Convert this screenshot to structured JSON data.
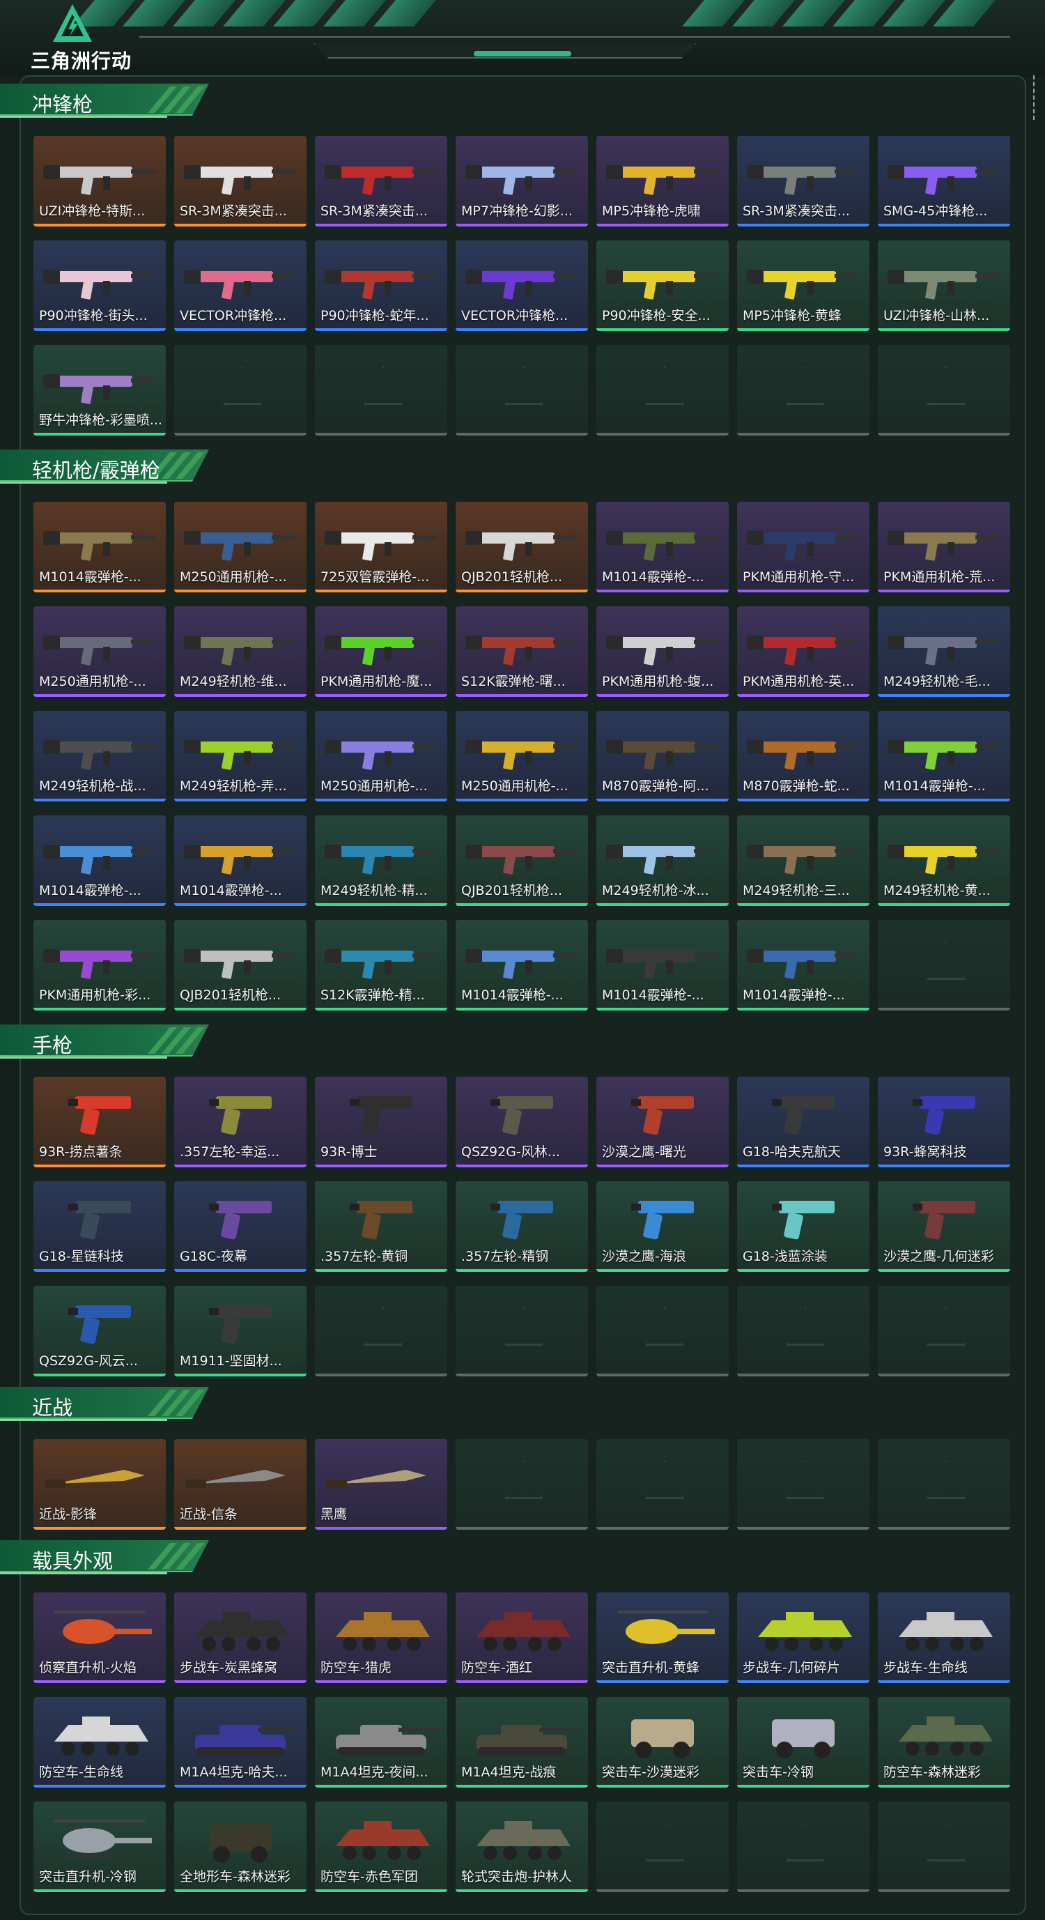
{
  "app": {
    "logo_text": "三角洲行动"
  },
  "colors": {
    "accent": "#38b586",
    "rarity_orange": "#ff8f30",
    "rarity_purple": "#9a5cff",
    "rarity_blue": "#3f82ff",
    "rarity_green": "#3bd98c"
  },
  "sections": [
    {
      "title": "冲锋枪",
      "items": [
        {
          "label": "UZI冲锋枪-特斯...",
          "rarity": "orange",
          "icon": "smg-icon",
          "tint": "#c9c9c9"
        },
        {
          "label": "SR-3M紧凑突击...",
          "rarity": "orange",
          "icon": "smg-icon",
          "tint": "#e0e0e0"
        },
        {
          "label": "SR-3M紧凑突击...",
          "rarity": "purple",
          "icon": "smg-icon",
          "tint": "#c02a2a"
        },
        {
          "label": "MP7冲锋枪-幻影...",
          "rarity": "purple",
          "icon": "smg-icon",
          "tint": "#9fb7e8"
        },
        {
          "label": "MP5冲锋枪-虎啸",
          "rarity": "purple",
          "icon": "smg-icon",
          "tint": "#e2b22a"
        },
        {
          "label": "SR-3M紧凑突击...",
          "rarity": "blue",
          "icon": "smg-icon",
          "tint": "#7a7f7c"
        },
        {
          "label": "SMG-45冲锋枪...",
          "rarity": "blue",
          "icon": "smg-icon",
          "tint": "#8a5cf0"
        },
        {
          "label": "P90冲锋枪-街头...",
          "rarity": "blue",
          "icon": "smg-icon",
          "tint": "#e9c6d6"
        },
        {
          "label": "VECTOR冲锋枪...",
          "rarity": "blue",
          "icon": "smg-icon",
          "tint": "#e36a8a"
        },
        {
          "label": "P90冲锋枪-蛇年...",
          "rarity": "blue",
          "icon": "smg-icon",
          "tint": "#b3372c"
        },
        {
          "label": "VECTOR冲锋枪...",
          "rarity": "blue",
          "icon": "smg-icon",
          "tint": "#6a3ad1"
        },
        {
          "label": "P90冲锋枪-安全...",
          "rarity": "green",
          "icon": "smg-icon",
          "tint": "#e6cf2a"
        },
        {
          "label": "MP5冲锋枪-黄蜂",
          "rarity": "green",
          "icon": "smg-icon",
          "tint": "#e8d22c"
        },
        {
          "label": "UZI冲锋枪-山林...",
          "rarity": "green",
          "icon": "smg-icon",
          "tint": "#7d8a74"
        },
        {
          "label": "野牛冲锋枪-彩墨喷...",
          "rarity": "green",
          "icon": "smg-icon",
          "tint": "#9f7fc4"
        },
        {
          "label": "",
          "rarity": "empty"
        },
        {
          "label": "",
          "rarity": "empty"
        },
        {
          "label": "",
          "rarity": "empty"
        },
        {
          "label": "",
          "rarity": "empty"
        },
        {
          "label": "",
          "rarity": "empty"
        },
        {
          "label": "",
          "rarity": "empty"
        }
      ]
    },
    {
      "title": "轻机枪/霰弹枪",
      "items": [
        {
          "label": "M1014霰弹枪-...",
          "rarity": "orange",
          "icon": "rifle-icon",
          "tint": "#8a7a4e"
        },
        {
          "label": "M250通用机枪-...",
          "rarity": "orange",
          "icon": "rifle-icon",
          "tint": "#3a5f95"
        },
        {
          "label": "725双管霰弹枪-...",
          "rarity": "orange",
          "icon": "rifle-icon",
          "tint": "#e9e9e9"
        },
        {
          "label": "QJB201轻机枪...",
          "rarity": "orange",
          "icon": "rifle-icon",
          "tint": "#d8d8d8"
        },
        {
          "label": "M1014霰弹枪-...",
          "rarity": "purple",
          "icon": "rifle-icon",
          "tint": "#5c6a3a"
        },
        {
          "label": "PKM通用机枪-守...",
          "rarity": "purple",
          "icon": "rifle-icon",
          "tint": "#2b3b6a"
        },
        {
          "label": "PKM通用机枪-荒...",
          "rarity": "purple",
          "icon": "rifle-icon",
          "tint": "#8a7a4e"
        },
        {
          "label": "M250通用机枪-...",
          "rarity": "purple",
          "icon": "rifle-icon",
          "tint": "#676a78"
        },
        {
          "label": "M249轻机枪-维...",
          "rarity": "purple",
          "icon": "rifle-icon",
          "tint": "#6e7552"
        },
        {
          "label": "PKM通用机枪-魔...",
          "rarity": "purple",
          "icon": "rifle-icon",
          "tint": "#5bd12a"
        },
        {
          "label": "S12K霰弹枪-曙...",
          "rarity": "purple",
          "icon": "rifle-icon",
          "tint": "#a33a2e"
        },
        {
          "label": "PKM通用机枪-蝮...",
          "rarity": "purple",
          "icon": "rifle-icon",
          "tint": "#cfcfcf"
        },
        {
          "label": "PKM通用机枪-英...",
          "rarity": "purple",
          "icon": "rifle-icon",
          "tint": "#b22a2a"
        },
        {
          "label": "M249轻机枪-毛...",
          "rarity": "blue",
          "icon": "rifle-icon",
          "tint": "#6a6f8a"
        },
        {
          "label": "M249轻机枪-战...",
          "rarity": "blue",
          "icon": "rifle-icon",
          "tint": "#4e4e4e"
        },
        {
          "label": "M249轻机枪-弄...",
          "rarity": "blue",
          "icon": "rifle-icon",
          "tint": "#9bd12a"
        },
        {
          "label": "M250通用机枪-...",
          "rarity": "blue",
          "icon": "rifle-icon",
          "tint": "#8a7fe0"
        },
        {
          "label": "M250通用机枪-...",
          "rarity": "blue",
          "icon": "rifle-icon",
          "tint": "#d6b02a"
        },
        {
          "label": "M870霰弹枪-阿...",
          "rarity": "blue",
          "icon": "rifle-icon",
          "tint": "#5a4a3a"
        },
        {
          "label": "M870霰弹枪-蛇...",
          "rarity": "blue",
          "icon": "rifle-icon",
          "tint": "#b06a2a"
        },
        {
          "label": "M1014霰弹枪-...",
          "rarity": "blue",
          "icon": "rifle-icon",
          "tint": "#7fd13a"
        },
        {
          "label": "M1014霰弹枪-...",
          "rarity": "blue",
          "icon": "rifle-icon",
          "tint": "#4a8fd6"
        },
        {
          "label": "M1014霰弹枪-...",
          "rarity": "blue",
          "icon": "rifle-icon",
          "tint": "#d6a02a"
        },
        {
          "label": "M249轻机枪-精...",
          "rarity": "green",
          "icon": "rifle-icon",
          "tint": "#2a86b0"
        },
        {
          "label": "QJB201轻机枪...",
          "rarity": "green",
          "icon": "rifle-icon",
          "tint": "#8a4a4a"
        },
        {
          "label": "M249轻机枪-冰...",
          "rarity": "green",
          "icon": "rifle-icon",
          "tint": "#9cc3e6"
        },
        {
          "label": "M249轻机枪-三...",
          "rarity": "green",
          "icon": "rifle-icon",
          "tint": "#8a7052"
        },
        {
          "label": "M249轻机枪-黄...",
          "rarity": "green",
          "icon": "rifle-icon",
          "tint": "#e6d02a"
        },
        {
          "label": "PKM通用机枪-彩...",
          "rarity": "green",
          "icon": "rifle-icon",
          "tint": "#9a4ad1"
        },
        {
          "label": "QJB201轻机枪...",
          "rarity": "green",
          "icon": "rifle-icon",
          "tint": "#bfbfbf"
        },
        {
          "label": "S12K霰弹枪-精...",
          "rarity": "green",
          "icon": "rifle-icon",
          "tint": "#2a8ab0"
        },
        {
          "label": "M1014霰弹枪-...",
          "rarity": "green",
          "icon": "rifle-icon",
          "tint": "#5a8ad6"
        },
        {
          "label": "M1014霰弹枪-...",
          "rarity": "green",
          "icon": "rifle-icon",
          "tint": "#3a3a3a"
        },
        {
          "label": "M1014霰弹枪-...",
          "rarity": "green",
          "icon": "rifle-icon",
          "tint": "#3a6ab0"
        },
        {
          "label": "",
          "rarity": "empty"
        }
      ]
    },
    {
      "title": "手枪",
      "items": [
        {
          "label": "93R-捞点薯条",
          "rarity": "orange",
          "icon": "pistol-icon",
          "tint": "#d93a2a"
        },
        {
          "label": ".357左轮-幸运...",
          "rarity": "purple",
          "icon": "pistol-icon",
          "tint": "#8a8a3a"
        },
        {
          "label": "93R-博士",
          "rarity": "purple",
          "icon": "pistol-icon",
          "tint": "#2f2f2f"
        },
        {
          "label": "QSZ92G-风林...",
          "rarity": "purple",
          "icon": "pistol-icon",
          "tint": "#5a5a4a"
        },
        {
          "label": "沙漠之鹰-曙光",
          "rarity": "purple",
          "icon": "pistol-icon",
          "tint": "#b0402a"
        },
        {
          "label": "G18-哈夫克航天",
          "rarity": "blue",
          "icon": "pistol-icon",
          "tint": "#3a3a3a"
        },
        {
          "label": "93R-蜂窝科技",
          "rarity": "blue",
          "icon": "pistol-icon",
          "tint": "#3a3ab0"
        },
        {
          "label": "G18-星链科技",
          "rarity": "blue",
          "icon": "pistol-icon",
          "tint": "#3a4a5a"
        },
        {
          "label": "G18C-夜幕",
          "rarity": "blue",
          "icon": "pistol-icon",
          "tint": "#6a4aa0"
        },
        {
          "label": ".357左轮-黄铜",
          "rarity": "green",
          "icon": "pistol-icon",
          "tint": "#6a4a2a"
        },
        {
          "label": ".357左轮-精钢",
          "rarity": "green",
          "icon": "pistol-icon",
          "tint": "#2a6aa0"
        },
        {
          "label": "沙漠之鹰-海浪",
          "rarity": "green",
          "icon": "pistol-icon",
          "tint": "#3a8ad6"
        },
        {
          "label": "G18-浅蓝涂装",
          "rarity": "green",
          "icon": "pistol-icon",
          "tint": "#6ac6c6"
        },
        {
          "label": "沙漠之鹰-几何迷彩",
          "rarity": "green",
          "icon": "pistol-icon",
          "tint": "#7a3a3a"
        },
        {
          "label": "QSZ92G-风云...",
          "rarity": "green",
          "icon": "pistol-icon",
          "tint": "#2a5ab0"
        },
        {
          "label": "M1911-坚固材...",
          "rarity": "green",
          "icon": "pistol-icon",
          "tint": "#3a3a3a"
        },
        {
          "label": "",
          "rarity": "empty"
        },
        {
          "label": "",
          "rarity": "empty"
        },
        {
          "label": "",
          "rarity": "empty"
        },
        {
          "label": "",
          "rarity": "empty"
        },
        {
          "label": "",
          "rarity": "empty"
        }
      ]
    },
    {
      "title": "近战",
      "items": [
        {
          "label": "近战-影锋",
          "rarity": "orange",
          "icon": "blade-icon",
          "tint": "#c9a23a"
        },
        {
          "label": "近战-信条",
          "rarity": "orange",
          "icon": "blade-icon",
          "tint": "#8a8a8a"
        },
        {
          "label": "黑鹰",
          "rarity": "purple",
          "icon": "blade-icon",
          "tint": "#b0a07a"
        },
        {
          "label": "",
          "rarity": "empty"
        },
        {
          "label": "",
          "rarity": "empty"
        },
        {
          "label": "",
          "rarity": "empty"
        },
        {
          "label": "",
          "rarity": "empty"
        }
      ]
    },
    {
      "title": "载具外观",
      "items": [
        {
          "label": "侦察直升机-火焰",
          "rarity": "purple",
          "icon": "helicopter-icon",
          "tint": "#d9532a"
        },
        {
          "label": "步战车-炭黑蜂窝",
          "rarity": "purple",
          "icon": "apc-icon",
          "tint": "#2f2f2f"
        },
        {
          "label": "防空车-猎虎",
          "rarity": "purple",
          "icon": "apc-icon",
          "tint": "#a8752a"
        },
        {
          "label": "防空车-酒红",
          "rarity": "purple",
          "icon": "apc-icon",
          "tint": "#7a2a2a"
        },
        {
          "label": "突击直升机-黄蜂",
          "rarity": "blue",
          "icon": "helicopter-icon",
          "tint": "#e0c02a"
        },
        {
          "label": "步战车-几何碎片",
          "rarity": "blue",
          "icon": "apc-icon",
          "tint": "#b8d12a"
        },
        {
          "label": "步战车-生命线",
          "rarity": "blue",
          "icon": "apc-icon",
          "tint": "#c9c9c9"
        },
        {
          "label": "防空车-生命线",
          "rarity": "blue",
          "icon": "apc-icon",
          "tint": "#d6d6d6"
        },
        {
          "label": "M1A4坦克-哈夫...",
          "rarity": "blue",
          "icon": "tank-icon",
          "tint": "#3a3a9a"
        },
        {
          "label": "M1A4坦克-夜间...",
          "rarity": "green",
          "icon": "tank-icon",
          "tint": "#8a8a8a"
        },
        {
          "label": "M1A4坦克-战痕",
          "rarity": "green",
          "icon": "tank-icon",
          "tint": "#4a4a3a"
        },
        {
          "label": "突击车-沙漠迷彩",
          "rarity": "green",
          "icon": "truck-icon",
          "tint": "#b8aa8a"
        },
        {
          "label": "突击车-冷钢",
          "rarity": "green",
          "icon": "truck-icon",
          "tint": "#b0b0c0"
        },
        {
          "label": "防空车-森林迷彩",
          "rarity": "green",
          "icon": "apc-icon",
          "tint": "#5a6a4a"
        },
        {
          "label": "突击直升机-冷钢",
          "rarity": "green",
          "icon": "helicopter-icon",
          "tint": "#9aa0a8"
        },
        {
          "label": "全地形车-森林迷彩",
          "rarity": "green",
          "icon": "atv-icon",
          "tint": "#3a3a2a"
        },
        {
          "label": "防空车-赤色军团",
          "rarity": "green",
          "icon": "apc-icon",
          "tint": "#9a3a2a"
        },
        {
          "label": "轮式突击炮-护林人",
          "rarity": "green",
          "icon": "apc-icon",
          "tint": "#6a6a5a"
        },
        {
          "label": "",
          "rarity": "empty"
        },
        {
          "label": "",
          "rarity": "empty"
        },
        {
          "label": "",
          "rarity": "empty"
        }
      ]
    }
  ]
}
